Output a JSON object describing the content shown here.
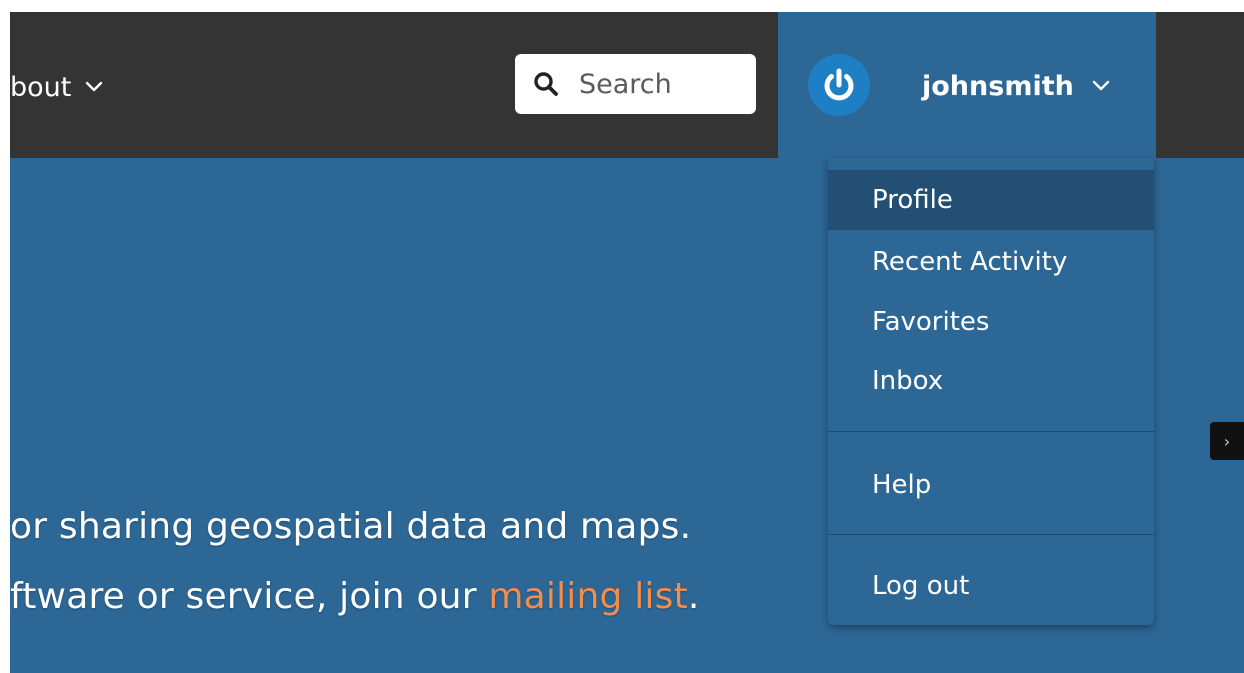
{
  "header": {
    "nav_about_label": "bout",
    "search": {
      "placeholder": "Search",
      "value": ""
    },
    "user": {
      "username": "johnsmith"
    }
  },
  "user_menu": {
    "items": [
      {
        "label": "Profile"
      },
      {
        "label": "Recent Activity"
      },
      {
        "label": "Favorites"
      },
      {
        "label": "Inbox"
      },
      {
        "label": "Help"
      },
      {
        "label": "Log out"
      }
    ]
  },
  "hero": {
    "line1": "or sharing geospatial data and maps.",
    "line2_prefix": "ftware or service, join our ",
    "line2_link": "mailing list",
    "line2_suffix": "."
  },
  "side_tab": {
    "label": "›"
  },
  "colors": {
    "header_bg": "#343434",
    "brand_blue": "#2d6796",
    "menu_active_bg": "#234f74",
    "link": "#f08e4e",
    "avatar_blue": "#1f7fc4"
  },
  "icons": {
    "search": "search-icon",
    "dropdown": "chevron-down-icon",
    "avatar": "power-icon",
    "side_tab": "chevron-right-icon"
  }
}
